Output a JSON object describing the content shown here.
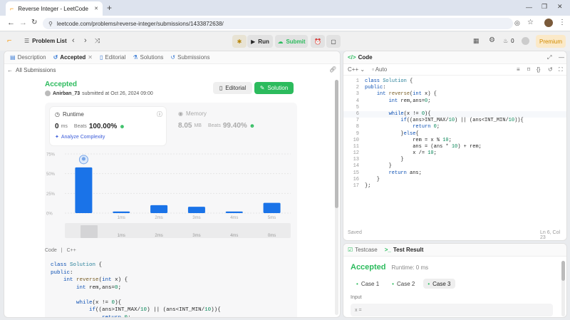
{
  "browser": {
    "tab_title": "Reverse Integer - LeetCode",
    "new_tab": "+",
    "url": "leetcode.com/problems/reverse-integer/submissions/1433872638/",
    "win_min": "—",
    "win_max": "❐",
    "win_close": "✕"
  },
  "nav": {
    "problem_list": "Problem List",
    "run": "Run",
    "submit": "Submit",
    "fire_count": "0",
    "premium": "Premium"
  },
  "left_tabs": {
    "description": "Description",
    "accepted": "Accepted",
    "editorial": "Editorial",
    "solutions": "Solutions",
    "submissions": "Submissions"
  },
  "submission": {
    "back": "All Submissions",
    "status": "Accepted",
    "user": "Anirban_73",
    "submitted_at": "submitted at Oct 26, 2024 09:00",
    "editorial_btn": "Editorial",
    "solution_btn": "Solution",
    "runtime_label": "Runtime",
    "runtime_value": "0",
    "runtime_unit": "ms",
    "beats_label": "Beats",
    "runtime_beats": "100.00%",
    "analyze": "Analyze Complexity",
    "memory_label": "Memory",
    "memory_value": "8.05",
    "memory_unit": "MB",
    "memory_beats": "99.40%",
    "code_lang_label": "Code",
    "code_lang": "C++"
  },
  "chart_data": {
    "type": "bar",
    "y_ticks": [
      "75%",
      "50%",
      "25%",
      "0%"
    ],
    "ylim": [
      0,
      75
    ],
    "categories": [
      "0ms",
      "1ms",
      "2ms",
      "3ms",
      "4ms",
      "5ms"
    ],
    "x_labels": [
      "",
      "1ms",
      "2ms",
      "3ms",
      "4ms",
      "5ms"
    ],
    "values": [
      58,
      2,
      10,
      8,
      2,
      13
    ],
    "minimap_labels": [
      "1ms",
      "2ms",
      "3ms",
      "4ms",
      "0ms"
    ],
    "bar_color": "#1a73e8"
  },
  "left_code": [
    "class Solution {",
    "public:",
    "    int reverse(int x) {",
    "        int rem,ans=0;",
    "",
    "        while(x != 0){",
    "            if((ans>INT_MAX/10) || (ans<INT_MIN/10)){",
    "                return 0;"
  ],
  "editor": {
    "title": "Code",
    "lang": "C++",
    "mode": "Auto",
    "saved": "Saved",
    "cursor_pos": "Ln 6, Col 23",
    "lines": [
      "class Solution {",
      "public:",
      "    int reverse(int x) {",
      "        int rem,ans=0;",
      "",
      "        while(x != 0){",
      "            if((ans>INT_MAX/10) || (ans<INT_MIN/10)){",
      "                return 0;",
      "            }else{",
      "                rem = x % 10;",
      "                ans = (ans * 10) + rem;",
      "                x /= 10;",
      "            }",
      "        }",
      "        return ans;",
      "    }",
      "};"
    ]
  },
  "bottom": {
    "testcase_tab": "Testcase",
    "result_tab": "Test Result",
    "status": "Accepted",
    "runtime": "Runtime: 0 ms",
    "cases": [
      "Case 1",
      "Case 2",
      "Case 3"
    ],
    "input_label": "Input",
    "input_prefix": "x ="
  }
}
